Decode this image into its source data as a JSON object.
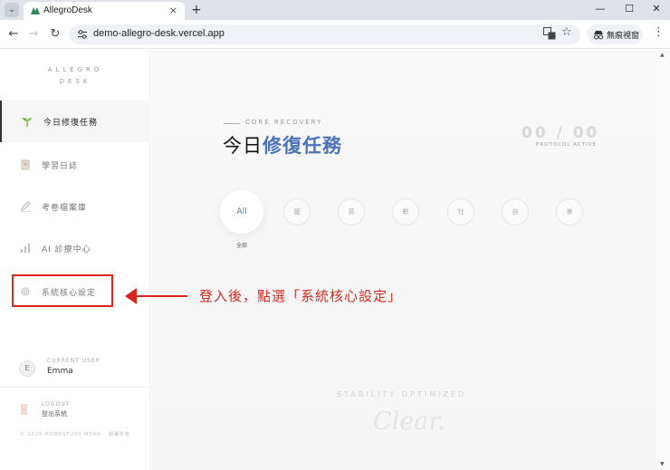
{
  "browser": {
    "tab_title": "AllegroDesk",
    "tab_close": "×",
    "new_tab": "+",
    "url": "demo-allegro-desk.vercel.app",
    "incognito_label": "無痕視窗",
    "window_controls": [
      "—",
      "☐",
      "✕"
    ]
  },
  "sidebar": {
    "brand_line1": "ALLEGRO",
    "brand_line2": "DESK",
    "items": [
      {
        "label": "今日修復任務",
        "icon": "sprout-icon",
        "active": true
      },
      {
        "label": "學習日誌",
        "icon": "notebook-icon",
        "active": false
      },
      {
        "label": "考卷檔案庫",
        "icon": "pencil-icon",
        "active": false
      },
      {
        "label": "AI 診療中心",
        "icon": "chart-icon",
        "active": false
      },
      {
        "label": "系統核心設定",
        "icon": "gear-icon",
        "active": false
      }
    ],
    "user_caption": "CURRENT USER",
    "user_initial": "E",
    "user_name": "Emma",
    "logout_caption": "LOGOUT",
    "logout_label": "登出系統",
    "copyright": "© 2026 HOMESTUDY MSMK · 版權所有"
  },
  "main": {
    "eyebrow": "CORE RECOVERY",
    "title_prefix": "今日",
    "title_accent": "修復任務",
    "counter": "00 / 00",
    "counter_caption": "PROTOCOL ACTIVE",
    "filters": [
      {
        "label": "All",
        "active": true
      },
      {
        "label": "國",
        "active": false
      },
      {
        "label": "英",
        "active": false
      },
      {
        "label": "數",
        "active": false
      },
      {
        "label": "社",
        "active": false
      },
      {
        "label": "自",
        "active": false
      },
      {
        "label": "美",
        "active": false
      }
    ],
    "filter_caption": "全部",
    "stability": "STABILITY OPTIMIZED",
    "clear": "Clear."
  },
  "annotation": {
    "text": "登入後，點選「系統核心設定」",
    "color": "#d9261c"
  },
  "colors": {
    "accent": "#4a72b8",
    "annotation": "#d9261c"
  }
}
